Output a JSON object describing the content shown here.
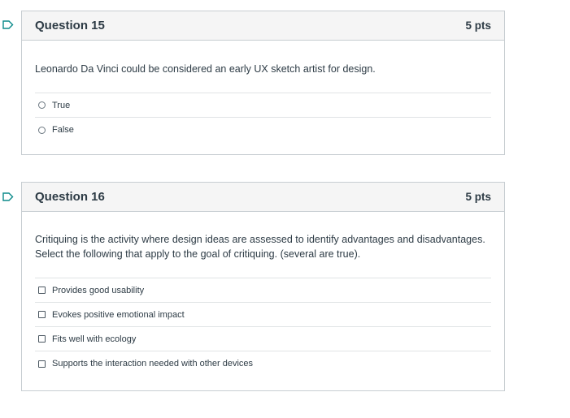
{
  "questions": [
    {
      "title": "Question 15",
      "points": "5 pts",
      "text": "Leonardo Da Vinci could be considered an early UX sketch artist for design.",
      "answer_type": "radio",
      "answers": [
        "True",
        "False"
      ]
    },
    {
      "title": "Question 16",
      "points": "5 pts",
      "text_line1": "Critiquing is the activity where design ideas are assessed to identify advantages and disadvantages.",
      "text_line2": "Select the following that apply to the goal of critiquing. (several are true).",
      "answer_type": "checkbox",
      "answers": [
        "Provides good usability",
        "Evokes positive emotional impact",
        "Fits well with ecology",
        "Supports the interaction needed with other devices"
      ]
    }
  ],
  "colors": {
    "flag": "#0b8a8a",
    "header_bg": "#f5f5f5",
    "border": "#c7cdd1",
    "text": "#2d3b45"
  },
  "icons": {
    "flag": "bookmark-flag-icon"
  }
}
